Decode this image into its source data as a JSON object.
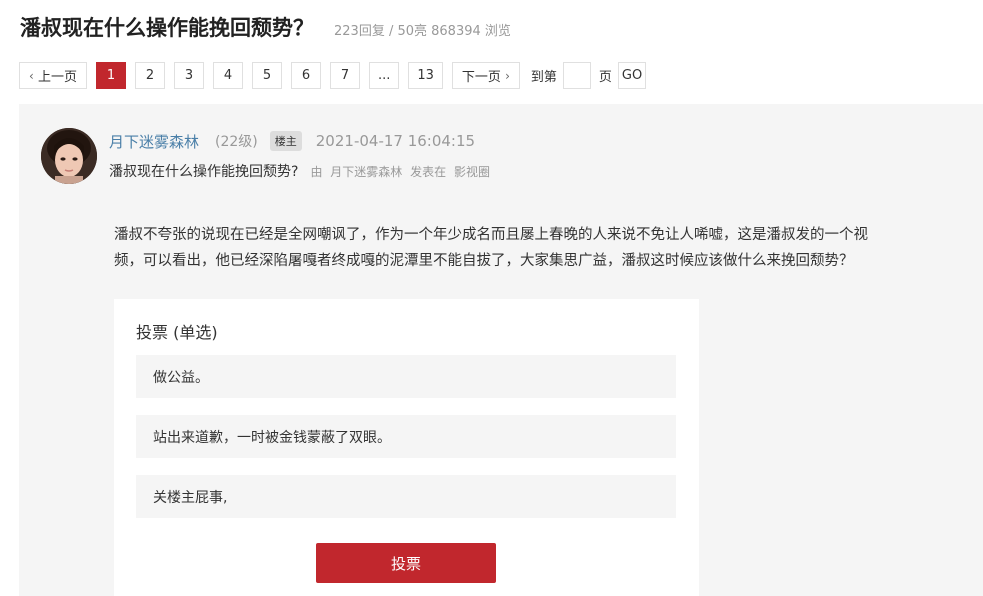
{
  "thread": {
    "title": "潘叔现在什么操作能挽回颓势？",
    "stats": "223回复 / 50亮 868394 浏览"
  },
  "pagination": {
    "prev_label": "上一页",
    "pages": [
      "1",
      "2",
      "3",
      "4",
      "5",
      "6",
      "7",
      "...",
      "13"
    ],
    "active_page": "1",
    "next_label": "下一页",
    "goto_label": "到第",
    "page_unit": "页",
    "go_label": "GO"
  },
  "post": {
    "author": "月下迷雾森林",
    "level": "(22级)",
    "badge": "楼主",
    "datetime": "2021-04-17 16:04:15",
    "sub_title": "潘叔现在什么操作能挽回颓势?",
    "posted_prefix": "由",
    "posted_by": "月下迷雾森林",
    "posted_in": "发表在",
    "board": "影视圈",
    "body_line1": "潘叔不夸张的说现在已经是全网嘲讽了，作为一个年少成名而且屡上春晚的人来说不免让人唏嘘，这是潘叔发的一个视",
    "body_line2": "频，可以看出，他已经深陷屠嘎者终成嘎的泥潭里不能自拔了，大家集思广益，潘叔这时候应该做什么来挽回颓势？"
  },
  "vote": {
    "title": "投票 (单选)",
    "options": [
      "做公益。",
      "站出来道歉，一时被金钱蒙蔽了双眼。",
      "关楼主屁事,"
    ],
    "submit_label": "投票"
  },
  "colors": {
    "accent": "#c1272d",
    "author_link": "#4a7fa8",
    "muted": "#999999",
    "panel_bg": "#f5f5f5"
  }
}
